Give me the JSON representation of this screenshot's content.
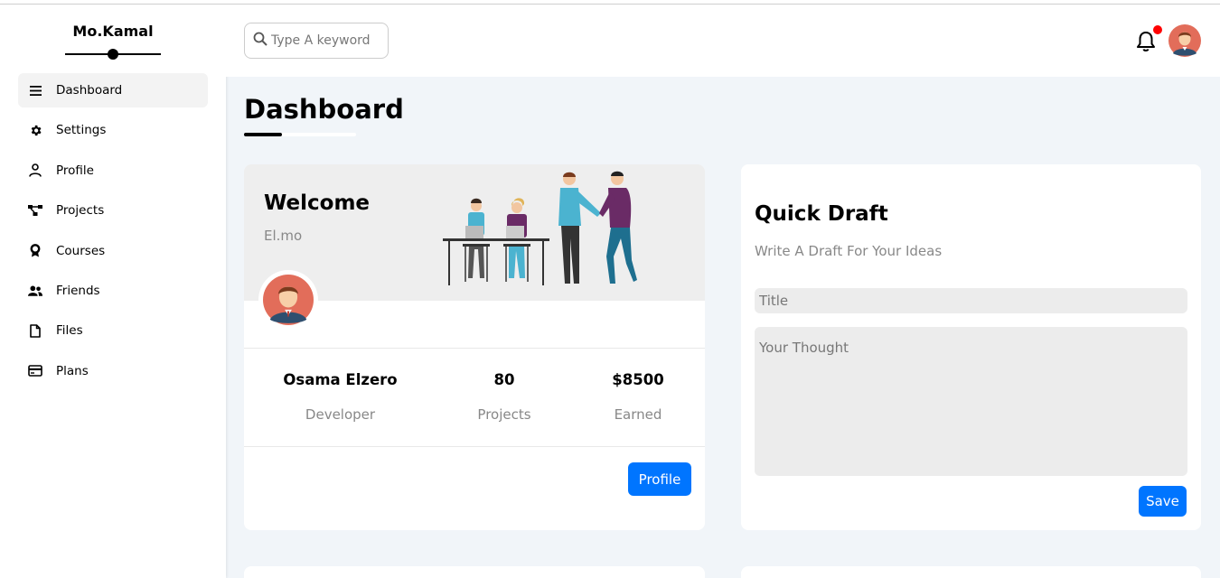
{
  "sidebar": {
    "brand": "Mo.Kamal",
    "items": [
      {
        "label": "Dashboard",
        "icon": "menu-icon",
        "active": true
      },
      {
        "label": "Settings",
        "icon": "gear-icon"
      },
      {
        "label": "Profile",
        "icon": "user-icon"
      },
      {
        "label": "Projects",
        "icon": "projects-icon"
      },
      {
        "label": "Courses",
        "icon": "award-icon"
      },
      {
        "label": "Friends",
        "icon": "friends-icon"
      },
      {
        "label": "Files",
        "icon": "file-icon"
      },
      {
        "label": "Plans",
        "icon": "credit-card-icon"
      }
    ]
  },
  "header": {
    "search_placeholder": "Type A keyword",
    "notification_dot_color": "#ff0000"
  },
  "page": {
    "title": "Dashboard"
  },
  "welcome": {
    "title": "Welcome",
    "subtitle": "El.mo",
    "stats": [
      {
        "value": "Osama Elzero",
        "label": "Developer"
      },
      {
        "value": "80",
        "label": "Projects"
      },
      {
        "value": "$8500",
        "label": "Earned"
      }
    ],
    "button": "Profile"
  },
  "draft": {
    "title": "Quick Draft",
    "subtitle": "Write A Draft For Your Ideas",
    "title_placeholder": "Title",
    "body_placeholder": "Your Thought",
    "button": "Save"
  },
  "colors": {
    "accent": "#0075ff",
    "background": "#f1f5f9"
  }
}
